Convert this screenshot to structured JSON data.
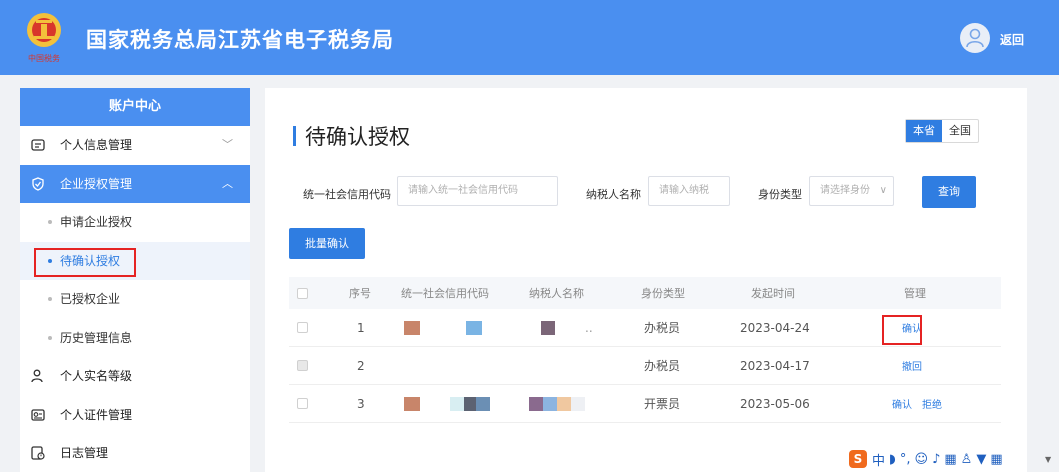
{
  "header": {
    "title": "国家税务总局江苏省电子税务局",
    "back_label": "返回",
    "brand_color": "#4a8ff0"
  },
  "sidebar": {
    "heading": "账户中心",
    "items": [
      {
        "label": "个人信息管理",
        "icon": "id-card-icon",
        "arrow": "﹀"
      },
      {
        "label": "企业授权管理",
        "icon": "shield-check-icon",
        "arrow": "︿"
      },
      {
        "label": "申请企业授权"
      },
      {
        "label": "待确认授权"
      },
      {
        "label": "已授权企业"
      },
      {
        "label": "历史管理信息"
      },
      {
        "label": "个人实名等级",
        "icon": "user-level-icon"
      },
      {
        "label": "个人证件管理",
        "icon": "certificate-icon"
      },
      {
        "label": "日志管理",
        "icon": "log-icon"
      }
    ]
  },
  "main": {
    "title": "待确认授权",
    "scope": {
      "local": "本省",
      "national": "全国"
    },
    "filters": {
      "credit_code_label": "统一社会信用代码",
      "credit_code_placeholder": "请输入统一社会信用代码",
      "taxpayer_label": "纳税人名称",
      "taxpayer_placeholder": "请输入纳税",
      "identity_label": "身份类型",
      "identity_placeholder": "请选择身份"
    },
    "query_label": "查询",
    "batch_label": "批量确认",
    "table": {
      "columns": [
        "序号",
        "统一社会信用代码",
        "纳税人名称",
        "身份类型",
        "发起时间",
        "管理"
      ],
      "rows": [
        {
          "index": "1",
          "trailing": "..",
          "identity": "办税员",
          "time": "2023-04-24",
          "actions": [
            "确认"
          ]
        },
        {
          "index": "2",
          "identity": "办税员",
          "time": "2023-04-17",
          "actions": [
            "撤回"
          ]
        },
        {
          "index": "3",
          "identity": "开票员",
          "time": "2023-05-06",
          "actions": [
            "确认",
            "拒绝"
          ]
        }
      ]
    }
  },
  "taskbar": {
    "ime_logo": "S",
    "ime_mode": "中"
  }
}
